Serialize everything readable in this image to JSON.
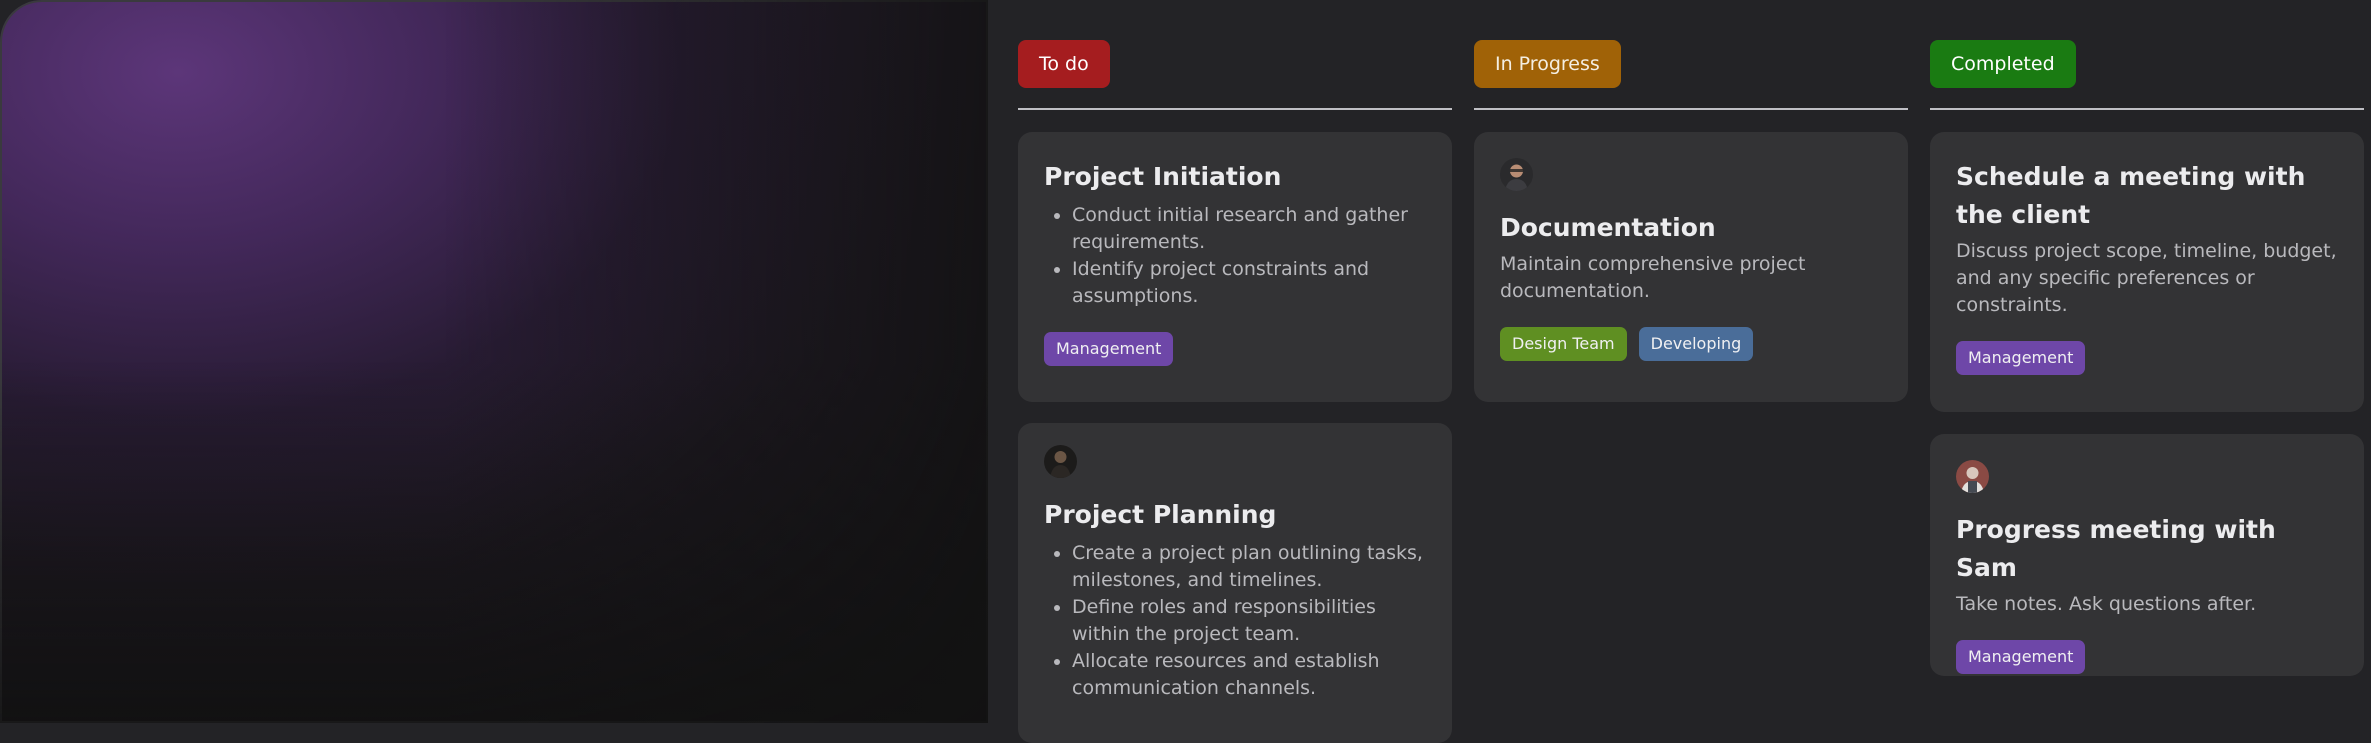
{
  "columns": {
    "todo": {
      "label": "To do",
      "cards": [
        {
          "title": "Project Initiation",
          "items": [
            "Conduct initial research and gather requirements.",
            "Identify project constraints and assumptions."
          ],
          "tags": [
            "Management"
          ]
        },
        {
          "avatar": "user-avatar",
          "title": "Project Planning",
          "items": [
            "Create a project plan outlining tasks, milestones, and timelines.",
            "Define roles and responsibilities within the project team.",
            "Allocate resources and establish communication channels."
          ]
        }
      ]
    },
    "in_progress": {
      "label": "In Progress",
      "cards": [
        {
          "avatar": "user-avatar",
          "title": "Documentation",
          "description": "Maintain comprehensive project documentation.",
          "tags": [
            "Design Team",
            "Developing"
          ]
        }
      ]
    },
    "completed": {
      "label": "Completed",
      "cards": [
        {
          "title": "Schedule a meeting with the client",
          "description": "Discuss project scope, timeline, budget, and any specific preferences or constraints.",
          "tags": [
            "Management"
          ]
        },
        {
          "avatar": "user-avatar",
          "title": "Progress meeting with Sam",
          "description": "Take notes. Ask questions after.",
          "tags": [
            "Management"
          ]
        }
      ]
    }
  },
  "colors": {
    "todo": "#a51d1f",
    "in_progress": "#a06207",
    "completed": "#1a7b12",
    "tag_management": "#6e47a8",
    "tag_design_team": "#5f8f22",
    "tag_developing": "#4a6d99",
    "card_bg": "#333335",
    "board_bg": "#232326"
  }
}
